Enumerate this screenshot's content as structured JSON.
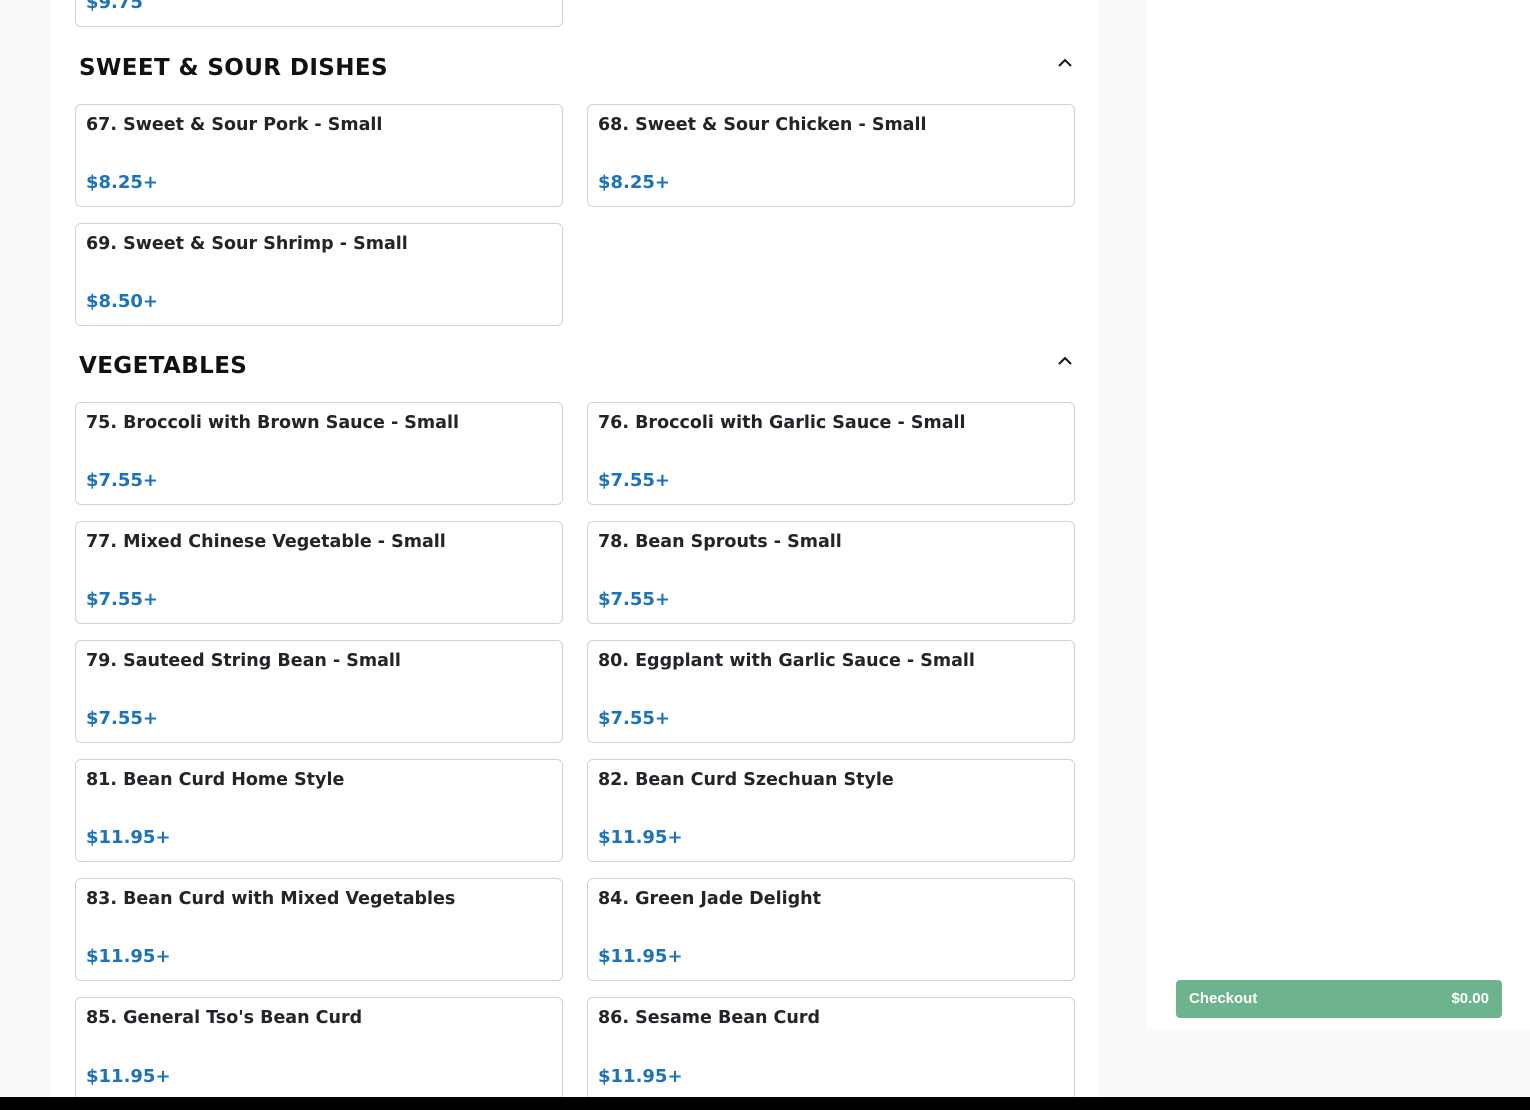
{
  "prev_item": {
    "price": "$9.75"
  },
  "sections": [
    {
      "title": "SWEET & SOUR DISHES",
      "items": [
        {
          "name": "67. Sweet & Sour Pork - Small",
          "price": "$8.25+"
        },
        {
          "name": "68. Sweet & Sour Chicken - Small",
          "price": "$8.25+"
        },
        {
          "name": "69. Sweet & Sour Shrimp - Small",
          "price": "$8.50+"
        }
      ]
    },
    {
      "title": "VEGETABLES",
      "items": [
        {
          "name": "75. Broccoli with Brown Sauce - Small",
          "price": "$7.55+"
        },
        {
          "name": "76. Broccoli with Garlic Sauce - Small",
          "price": "$7.55+"
        },
        {
          "name": "77. Mixed Chinese Vegetable - Small",
          "price": "$7.55+"
        },
        {
          "name": "78. Bean Sprouts - Small",
          "price": "$7.55+"
        },
        {
          "name": "79. Sauteed String Bean - Small",
          "price": "$7.55+"
        },
        {
          "name": "80. Eggplant with Garlic Sauce - Small",
          "price": "$7.55+"
        },
        {
          "name": "81. Bean Curd Home Style",
          "price": "$11.95+"
        },
        {
          "name": "82. Bean Curd Szechuan Style",
          "price": "$11.95+"
        },
        {
          "name": "83. Bean Curd with Mixed Vegetables",
          "price": "$11.95+"
        },
        {
          "name": "84. Green Jade Delight",
          "price": "$11.95+"
        },
        {
          "name": "85. General Tso's Bean Curd",
          "price": "$11.95+"
        },
        {
          "name": "86. Sesame Bean Curd",
          "price": "$11.95+"
        }
      ]
    }
  ],
  "cart": {
    "checkout_label": "Checkout",
    "total": "$0.00"
  },
  "colors": {
    "price": "#1a73bb",
    "checkout": "#6db38e",
    "border": "#cfd3d7"
  },
  "icons": {
    "collapse": "chevron-up-icon"
  }
}
